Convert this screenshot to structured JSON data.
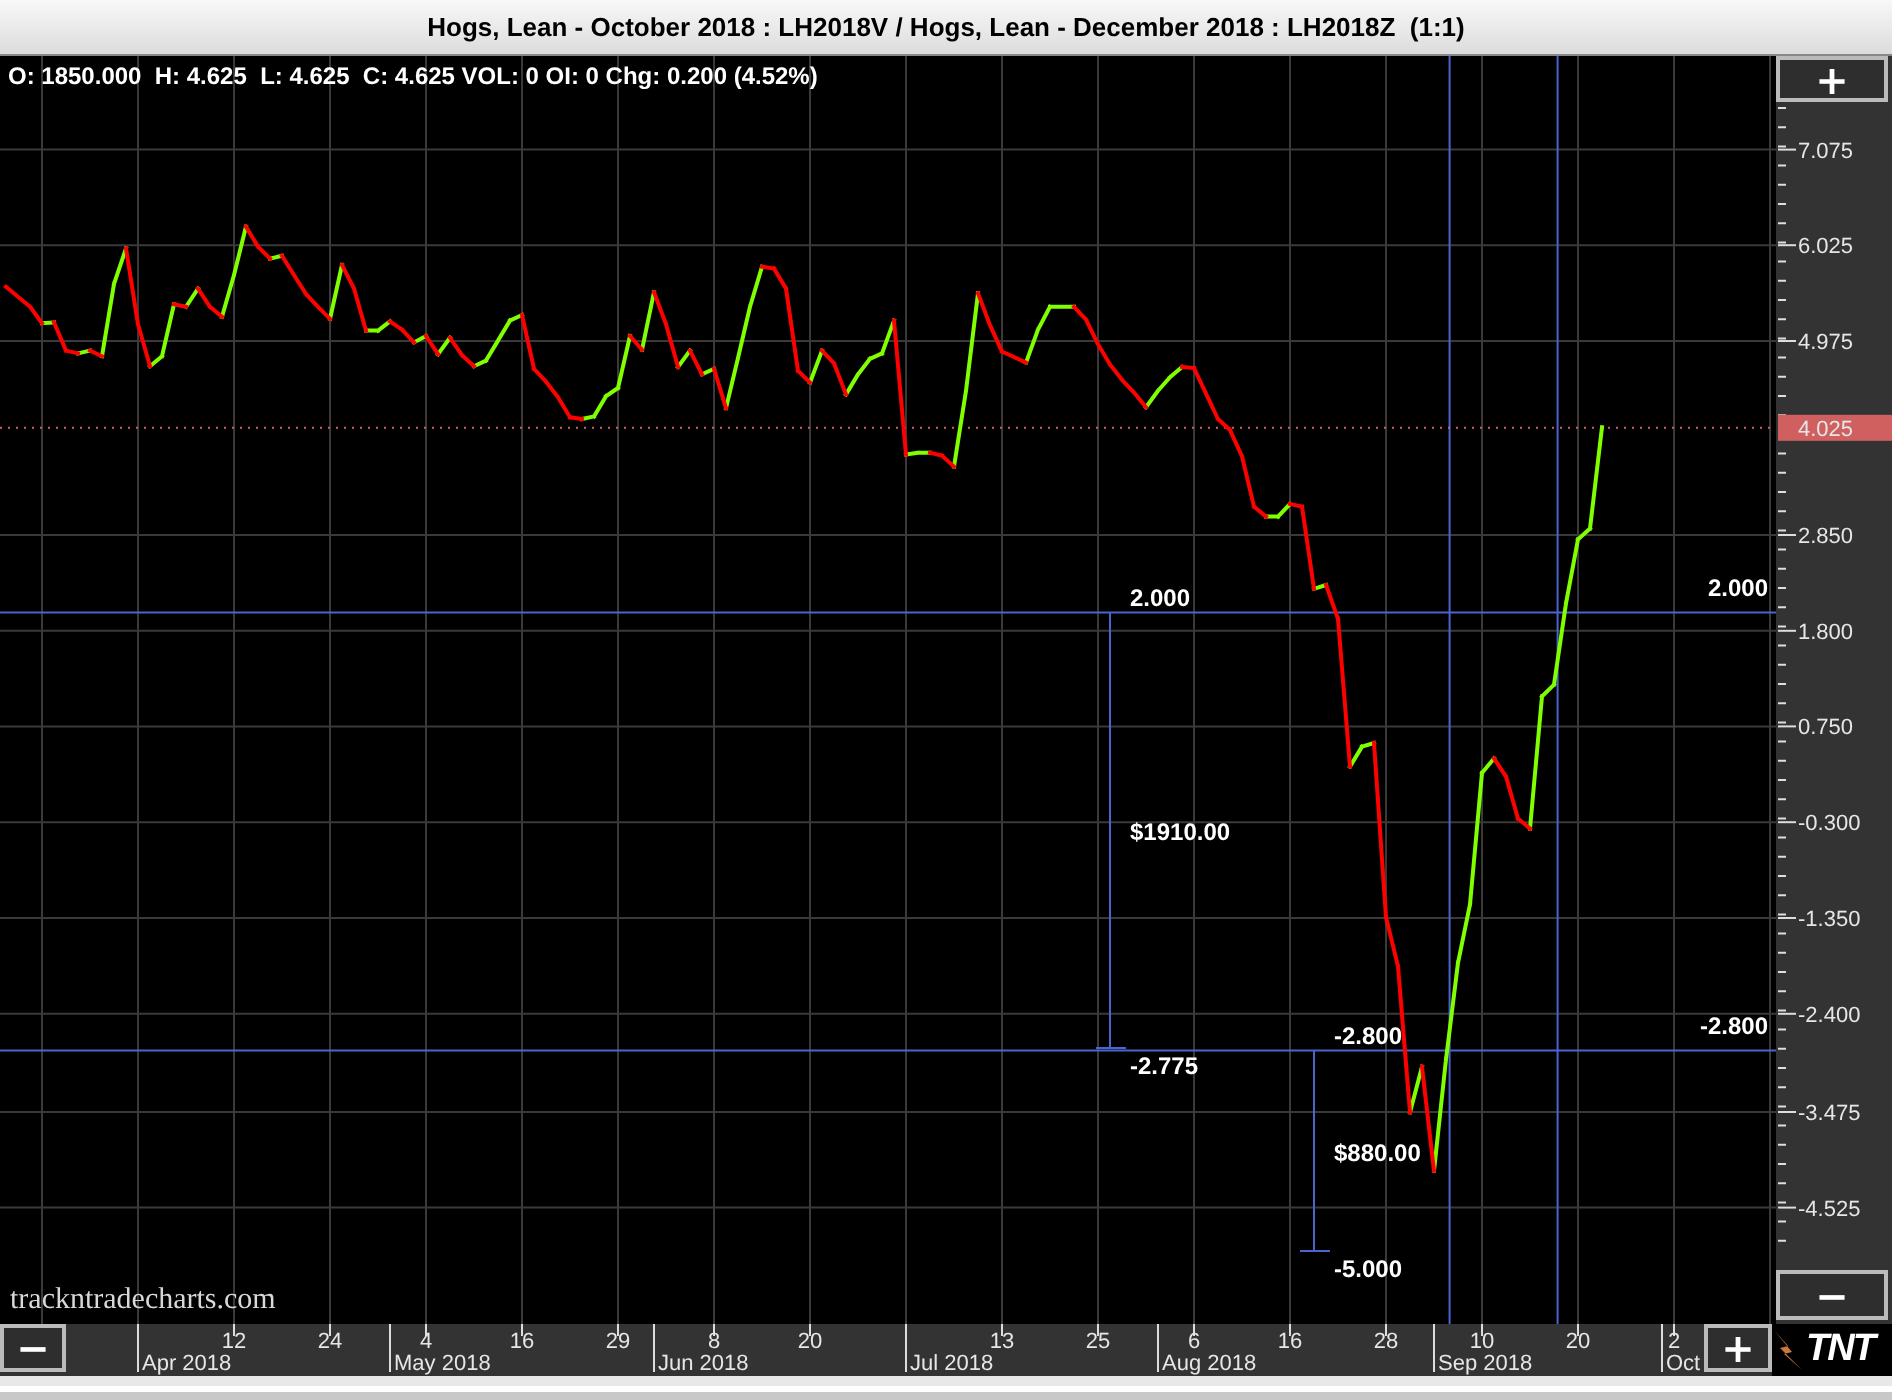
{
  "window": {
    "title": "Hogs, Lean - October 2018 : LH2018V / Hogs, Lean - December 2018 : LH2018Z  (1:1)"
  },
  "chart": {
    "info": "O: 1850.000  H: 4.625  L: 4.625  C: 4.625 VOL: 0 OI: 0 Chg: 0.200 (4.52%)",
    "watermark": "trackntradecharts.com",
    "months": [
      "Apr 2018",
      "May 2018",
      "Jun 2018",
      "Jul 2018",
      "Aug 2018",
      "Sep 2018",
      "Oct"
    ],
    "chart_data": {
      "type": "line",
      "grid": true,
      "categories": [
        null,
        null,
        null,
        null,
        null,
        null,
        null,
        null,
        null,
        null,
        null,
        null,
        null,
        null,
        null,
        null,
        null,
        null,
        null,
        "12",
        null,
        null,
        null,
        null,
        null,
        null,
        null,
        "24",
        null,
        null,
        null,
        null,
        null,
        null,
        null,
        "4",
        null,
        null,
        null,
        null,
        null,
        null,
        null,
        "16",
        null,
        null,
        null,
        null,
        null,
        null,
        null,
        "29",
        null,
        null,
        null,
        null,
        null,
        null,
        null,
        "8",
        null,
        null,
        null,
        null,
        null,
        null,
        null,
        "20",
        null,
        null,
        null,
        null,
        null,
        null,
        null,
        null,
        null,
        null,
        null,
        null,
        null,
        null,
        null,
        "13",
        null,
        null,
        null,
        null,
        null,
        null,
        null,
        "25",
        null,
        null,
        null,
        null,
        null,
        null,
        null,
        "6",
        null,
        null,
        null,
        null,
        null,
        null,
        null,
        "16",
        null,
        null,
        null,
        null,
        null,
        null,
        null,
        "28",
        null,
        null,
        null,
        null,
        null,
        null,
        null,
        "10",
        null,
        null,
        null,
        null,
        null,
        null,
        null,
        "20",
        null,
        null,
        null,
        null,
        null,
        null,
        null,
        "2",
        null,
        null,
        null,
        null,
        null,
        null,
        null,
        null
      ],
      "series": [
        {
          "color": "#80ff00",
          "values": [
            null,
            null,
            null,
            5.17,
            5.18,
            null,
            4.84,
            4.87,
            4.81,
            5.6,
            5.99,
            null,
            4.7,
            4.81,
            5.38,
            5.35,
            5.55,
            null,
            5.24,
            5.7,
            6.23,
            null,
            5.88,
            5.91,
            null,
            null,
            null,
            5.22,
            5.81,
            null,
            5.09,
            5.09,
            5.19,
            null,
            4.96,
            5.03,
            4.83,
            5.01,
            null,
            4.7,
            4.76,
            4.98,
            5.2,
            5.26,
            null,
            null,
            null,
            null,
            4.12,
            4.15,
            4.37,
            4.46,
            5.03,
            4.88,
            5.51,
            null,
            4.69,
            4.87,
            4.61,
            4.67,
            4.24,
            4.79,
            5.35,
            5.79,
            null,
            null,
            null,
            4.52,
            4.87,
            null,
            4.39,
            4.61,
            4.78,
            4.84,
            5.2,
            3.73,
            3.75,
            3.75,
            null,
            3.6,
            4.43,
            5.5,
            null,
            null,
            null,
            4.74,
            5.1,
            5.35,
            5.35,
            5.35,
            null,
            null,
            null,
            null,
            null,
            4.25,
            4.43,
            4.58,
            4.69,
            null,
            null,
            null,
            null,
            null,
            null,
            3.05,
            3.05,
            3.19,
            null,
            2.26,
            2.3,
            null,
            0.31,
            0.53,
            0.57,
            null,
            null,
            -3.48,
            -2.98,
            -4.12,
            -2.9,
            -1.84,
            -1.2,
            0.24,
            0.4,
            null,
            null,
            -0.37,
            1.08,
            1.21,
            2.1,
            2.8,
            2.92,
            4.03,
            null,
            null,
            null,
            null,
            null,
            null,
            null,
            null,
            null,
            null,
            null,
            null,
            null,
            null
          ]
        },
        {
          "color": "#ff0000",
          "values": [
            5.57,
            5.46,
            5.35,
            5.17,
            5.18,
            4.87,
            4.84,
            4.87,
            4.81,
            null,
            5.99,
            5.16,
            4.7,
            null,
            5.38,
            5.35,
            5.55,
            5.35,
            5.24,
            null,
            6.23,
            6.01,
            5.88,
            5.91,
            5.7,
            5.49,
            5.35,
            5.22,
            5.81,
            5.55,
            5.09,
            null,
            5.19,
            5.1,
            4.96,
            5.03,
            4.83,
            5.01,
            4.82,
            4.7,
            null,
            null,
            null,
            5.26,
            4.67,
            4.53,
            4.36,
            4.14,
            4.12,
            null,
            null,
            null,
            5.03,
            4.88,
            5.51,
            5.16,
            4.69,
            4.87,
            4.61,
            4.67,
            4.24,
            null,
            null,
            5.79,
            5.77,
            5.55,
            4.65,
            4.52,
            4.87,
            4.73,
            4.39,
            null,
            null,
            null,
            5.2,
            3.73,
            null,
            3.75,
            3.72,
            3.6,
            null,
            5.5,
            5.15,
            4.86,
            4.8,
            4.74,
            null,
            null,
            null,
            5.35,
            5.21,
            4.94,
            4.72,
            4.55,
            4.41,
            4.25,
            null,
            null,
            4.69,
            4.68,
            4.4,
            4.12,
            4.0,
            3.71,
            3.16,
            3.05,
            null,
            3.19,
            3.16,
            2.26,
            2.3,
            1.93,
            0.31,
            null,
            0.57,
            -1.34,
            -1.88,
            -3.48,
            -2.98,
            -4.12,
            null,
            null,
            null,
            null,
            0.4,
            0.2,
            -0.26,
            -0.37,
            null,
            null,
            null,
            null,
            null,
            null,
            null,
            null,
            null,
            null,
            null,
            null,
            null,
            null,
            null,
            null,
            null,
            null,
            null,
            null
          ]
        }
      ],
      "ylim": [
        -5.8,
        8.1
      ],
      "yticks": [
        {
          "value": 7.075,
          "label": "7.075"
        },
        {
          "value": 6.025,
          "label": "6.025"
        },
        {
          "value": 4.975,
          "label": "4.975"
        },
        {
          "value": 2.85,
          "label": "2.850"
        },
        {
          "value": 1.8,
          "label": "1.800"
        },
        {
          "value": 0.75,
          "label": "0.750"
        },
        {
          "value": -0.3,
          "label": "-0.300"
        },
        {
          "value": -1.35,
          "label": "-1.350"
        },
        {
          "value": -2.4,
          "label": "-2.400"
        },
        {
          "value": -3.475,
          "label": "-3.475"
        },
        {
          "value": -4.525,
          "label": "-4.525"
        }
      ],
      "ref_lines": [
        {
          "axis": "y",
          "value": 4.025,
          "label": "4.025",
          "color": "#d06060"
        },
        {
          "axis": "y",
          "value": 2.0,
          "label": "2.000",
          "color": "#4a64d0"
        },
        {
          "axis": "y",
          "value": -2.8,
          "label": "-2.800",
          "color": "#4a64d0"
        }
      ],
      "annotations": [
        "2.000",
        "$1910.00",
        "-2.775",
        "-2.800",
        "$880.00",
        "-5.000"
      ]
    }
  },
  "buttons": {
    "price_zoom_in": "+",
    "price_zoom_out": "−",
    "time_zoom_out": "−",
    "time_zoom_in": "+"
  },
  "logo": {
    "text": "TNT"
  }
}
